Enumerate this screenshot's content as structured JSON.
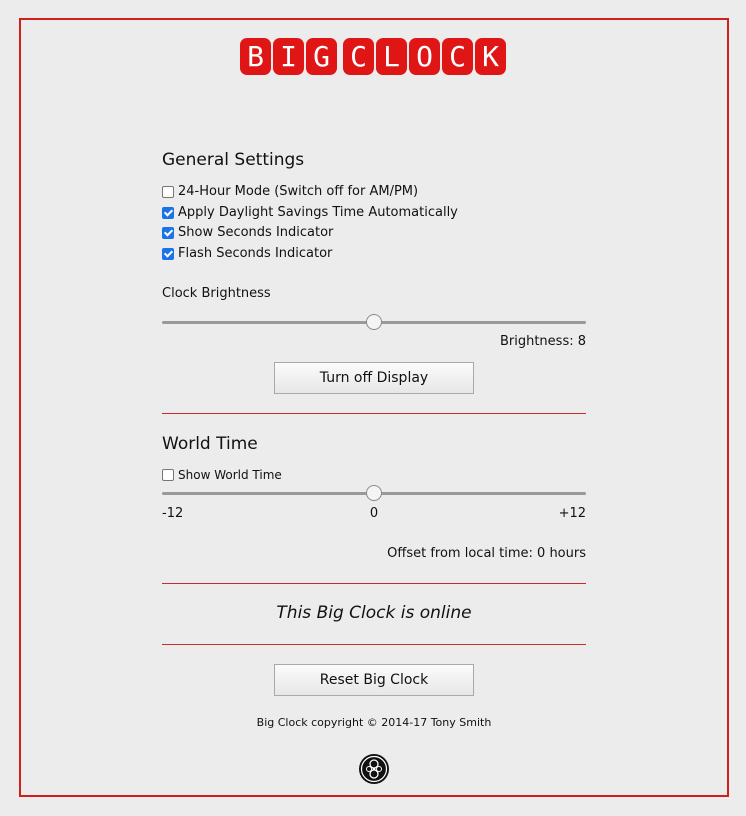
{
  "logo": {
    "word1": [
      "B",
      "I",
      "G"
    ],
    "word2": [
      "C",
      "L",
      "O",
      "C",
      "K"
    ]
  },
  "general": {
    "heading": "General Settings",
    "options": [
      {
        "label": "24-Hour Mode (Switch off for AM/PM)",
        "checked": false
      },
      {
        "label": "Apply Daylight Savings Time Automatically",
        "checked": true
      },
      {
        "label": "Show Seconds Indicator",
        "checked": true
      },
      {
        "label": "Flash Seconds Indicator",
        "checked": true
      }
    ],
    "brightness_label": "Clock Brightness",
    "brightness_fraction": 0.5,
    "brightness_readout": "Brightness: 8",
    "turn_off_label": "Turn off Display"
  },
  "world": {
    "heading": "World Time",
    "show_label": "Show World Time",
    "show_checked": false,
    "offset_fraction": 0.5,
    "min_label": "-12",
    "mid_label": "0",
    "max_label": "+12",
    "offset_readout": "Offset from local time: 0 hours"
  },
  "status": "This Big Clock is online",
  "reset_label": "Reset Big Clock",
  "copyright": "Big Clock copyright © 2014-17 Tony Smith",
  "colors": {
    "accent": "#e01616",
    "rule": "#c92a2a",
    "checkbox": "#1a73e8"
  },
  "footer_icon": "tardis-seal-icon"
}
